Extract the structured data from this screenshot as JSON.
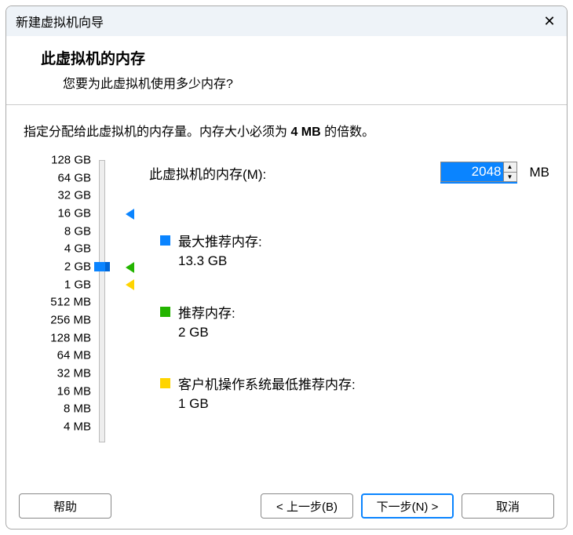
{
  "window": {
    "title": "新建虚拟机向导"
  },
  "header": {
    "title": "此虚拟机的内存",
    "subtitle": "您要为此虚拟机使用多少内存?"
  },
  "description": {
    "pre": "指定分配给此虚拟机的内存量。内存大小必须为 ",
    "bold": "4 MB",
    "post": " 的倍数。"
  },
  "scale": {
    "labels": [
      "128 GB",
      "64 GB",
      "32 GB",
      "16 GB",
      "8 GB",
      "4 GB",
      "2 GB",
      "1 GB",
      "512 MB",
      "256 MB",
      "128 MB",
      "64 MB",
      "32 MB",
      "16 MB",
      "8 MB",
      "4 MB"
    ]
  },
  "memory_input": {
    "label": "此虚拟机的内存(M):",
    "value": "2048",
    "unit": "MB"
  },
  "info": {
    "max": {
      "label": "最大推荐内存:",
      "value": "13.3 GB"
    },
    "rec": {
      "label": "推荐内存:",
      "value": "2 GB"
    },
    "min": {
      "label": "客户机操作系统最低推荐内存:",
      "value": "1 GB"
    }
  },
  "buttons": {
    "help": "帮助",
    "back": "< 上一步(B)",
    "next": "下一步(N) >",
    "cancel": "取消"
  },
  "colors": {
    "accent": "#0a84ff",
    "green": "#23b400",
    "yellow": "#ffd400"
  }
}
